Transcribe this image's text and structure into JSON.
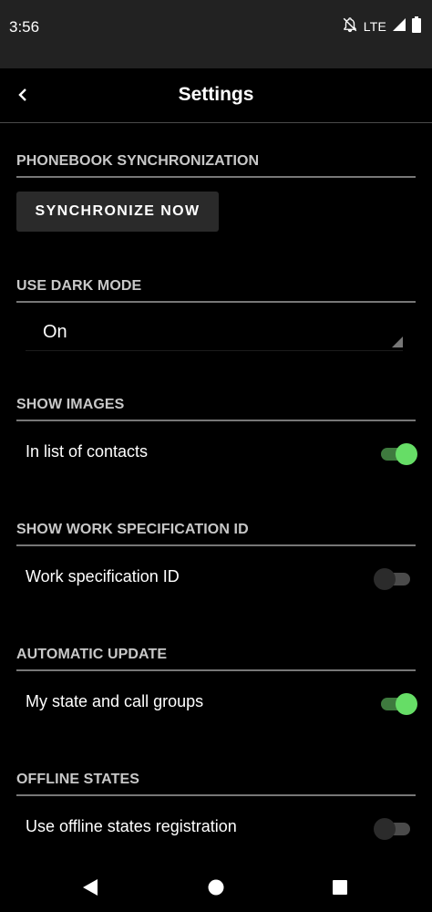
{
  "status_bar": {
    "time": "3:56",
    "network": "LTE",
    "icons": [
      "notifications-off-icon",
      "signal-icon",
      "battery-icon"
    ]
  },
  "app_bar": {
    "title": "Settings",
    "back_icon": "chevron-left-icon"
  },
  "sections": {
    "phonebook": {
      "header": "PHONEBOOK SYNCHRONIZATION",
      "button_label": "SYNCHRONIZE NOW"
    },
    "dark_mode": {
      "header": "USE DARK MODE",
      "selected_value": "On"
    },
    "show_images": {
      "header": "SHOW IMAGES",
      "row_label": "In list of contacts",
      "enabled": true
    },
    "work_spec": {
      "header": "SHOW WORK SPECIFICATION ID",
      "row_label": "Work specification ID",
      "enabled": false
    },
    "auto_update": {
      "header": "AUTOMATIC UPDATE",
      "row_label": "My state and call groups",
      "enabled": true
    },
    "offline_states": {
      "header": "OFFLINE STATES",
      "row_label": "Use offline states registration",
      "enabled": false
    }
  },
  "nav_bar": {
    "icons": [
      "back-triangle-icon",
      "home-circle-icon",
      "recents-square-icon"
    ]
  },
  "colors": {
    "toggle_on_thumb": "#66dd66",
    "toggle_on_track": "#3e7a3e",
    "toggle_off_thumb": "#2b2b2b",
    "toggle_off_track": "#4a4a4a",
    "section_header": "#c8c8c8",
    "divider": "#777777"
  }
}
